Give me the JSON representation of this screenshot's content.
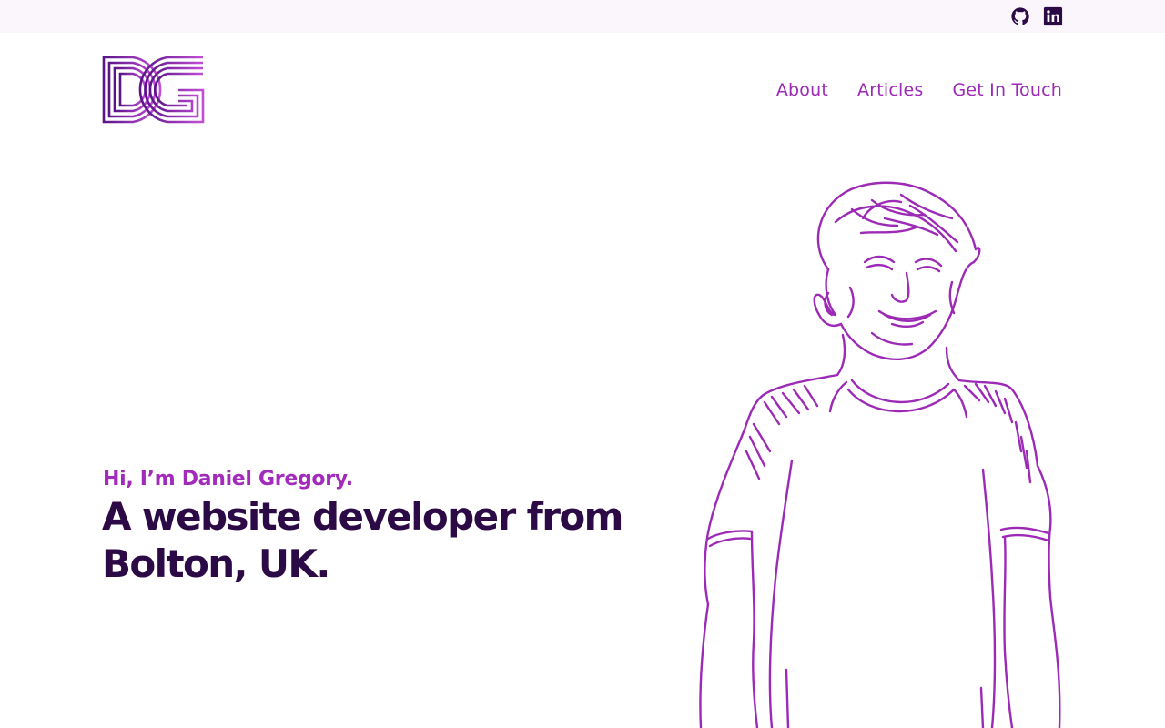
{
  "header": {
    "social_links": [
      {
        "label": "GitHub",
        "icon": "github-icon"
      },
      {
        "label": "LinkedIn",
        "icon": "linkedin-icon"
      }
    ],
    "logo": {
      "text": "DG"
    },
    "nav": [
      {
        "label": "About"
      },
      {
        "label": "Articles"
      },
      {
        "label": "Get In Touch"
      }
    ]
  },
  "hero": {
    "greeting": "Hi, I’m Daniel Gregory.",
    "headline": "A website developer from Bolton, UK."
  },
  "colors": {
    "accent": "#9c2ab6",
    "heading": "#2c0a45",
    "topbar_bg": "#fbf6fb",
    "icon_dark": "#2c0a45"
  }
}
